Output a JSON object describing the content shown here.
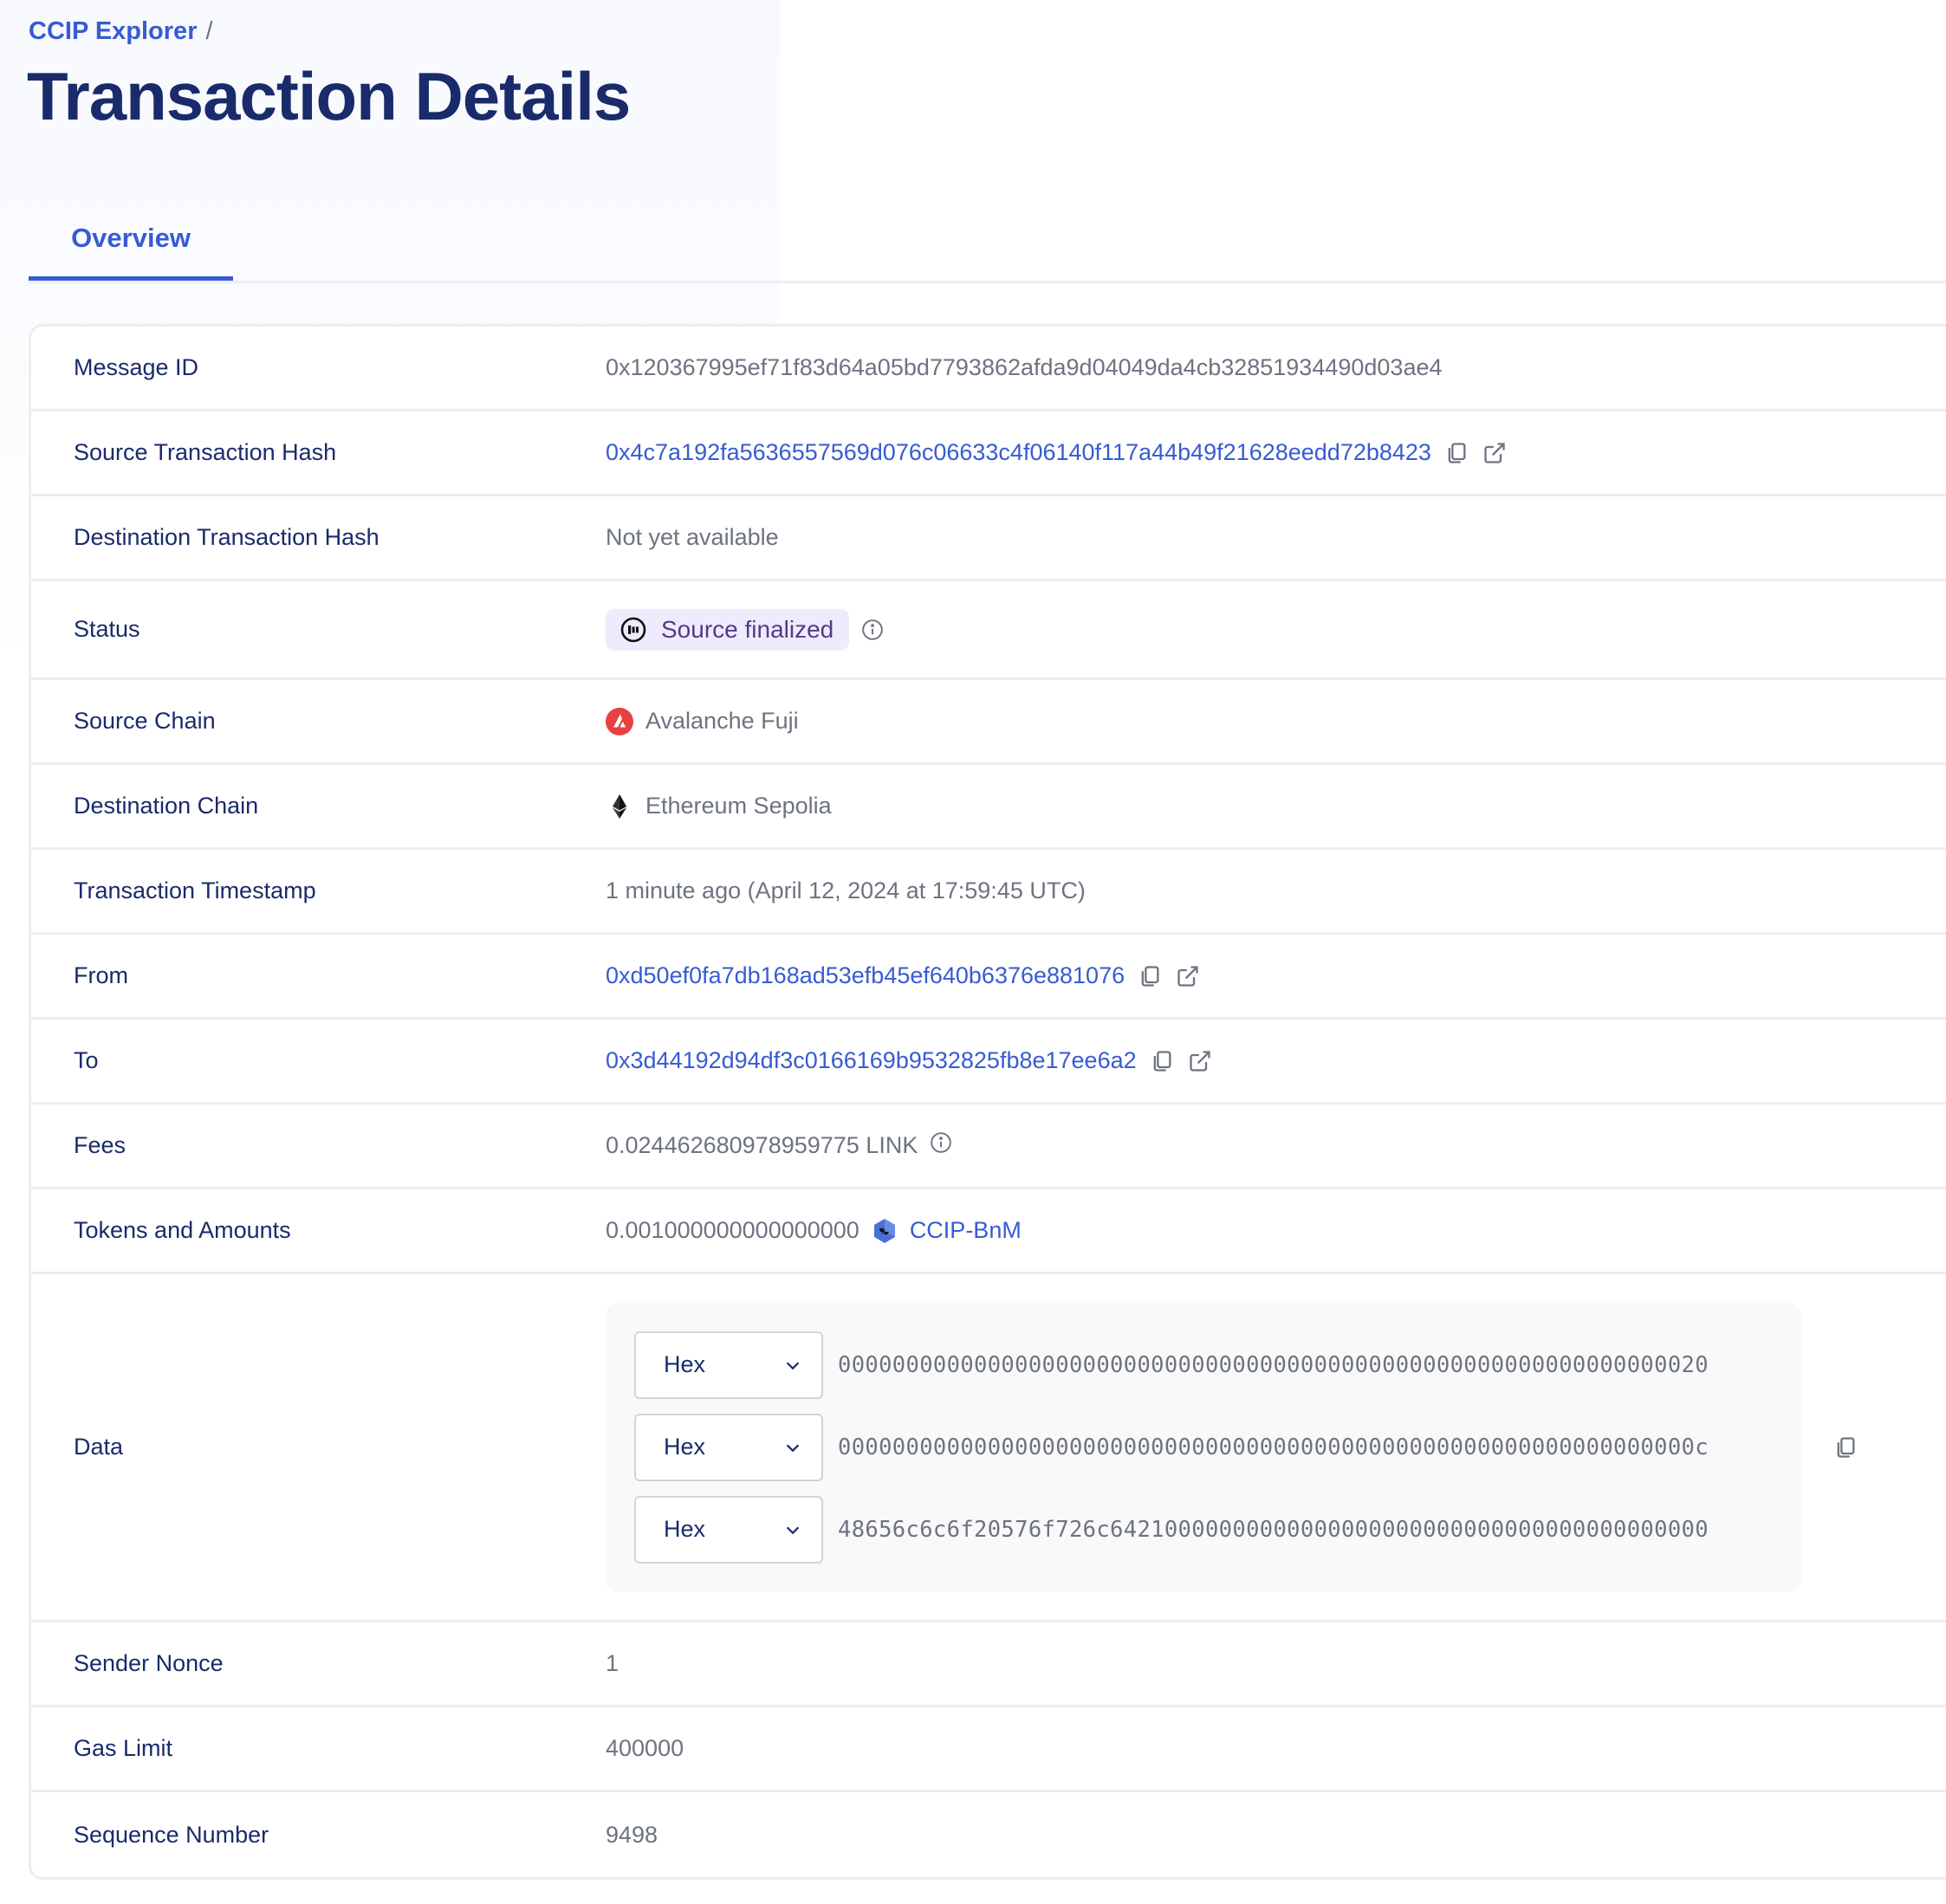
{
  "breadcrumb": {
    "root": "CCIP Explorer",
    "separator": "/"
  },
  "page_title": "Transaction Details",
  "tabs": [
    {
      "label": "Overview",
      "active": true
    }
  ],
  "colors": {
    "accent": "#375bd2",
    "heading": "#1a2b6b",
    "muted": "#6d7380",
    "badge_bg": "#efebfc",
    "badge_text": "#4f3c8c",
    "avalanche_red": "#e84142"
  },
  "details": {
    "message_id": {
      "label": "Message ID",
      "value": "0x120367995ef71f83d64a05bd7793862afda9d04049da4cb32851934490d03ae4"
    },
    "source_tx_hash": {
      "label": "Source Transaction Hash",
      "value": "0x4c7a192fa5636557569d076c06633c4f06140f117a44b49f21628eedd72b8423",
      "icons": [
        "copy-icon",
        "external-link-icon"
      ]
    },
    "dest_tx_hash": {
      "label": "Destination Transaction Hash",
      "value": "Not yet available"
    },
    "status": {
      "label": "Status",
      "value": "Source finalized",
      "icon": "status-finalized-icon",
      "info_icon": "info-icon"
    },
    "source_chain": {
      "label": "Source Chain",
      "value": "Avalanche Fuji",
      "icon": "avalanche-icon"
    },
    "dest_chain": {
      "label": "Destination Chain",
      "value": "Ethereum Sepolia",
      "icon": "ethereum-icon"
    },
    "timestamp": {
      "label": "Transaction Timestamp",
      "value": "1 minute ago (April 12, 2024 at 17:59:45 UTC)"
    },
    "from": {
      "label": "From",
      "value": "0xd50ef0fa7db168ad53efb45ef640b6376e881076",
      "icons": [
        "copy-icon",
        "external-link-icon"
      ]
    },
    "to": {
      "label": "To",
      "value": "0x3d44192d94df3c0166169b9532825fb8e17ee6a2",
      "icons": [
        "copy-icon",
        "external-link-icon"
      ]
    },
    "fees": {
      "label": "Fees",
      "value": "0.024462680978959775 LINK",
      "info_icon": "info-icon"
    },
    "tokens": {
      "label": "Tokens and Amounts",
      "amount": "0.001000000000000000",
      "token": "CCIP-BnM",
      "icon": "ccip-bnm-token-icon"
    },
    "data": {
      "label": "Data",
      "lines": [
        {
          "format": "Hex",
          "value": "0000000000000000000000000000000000000000000000000000000000000020"
        },
        {
          "format": "Hex",
          "value": "000000000000000000000000000000000000000000000000000000000000000c"
        },
        {
          "format": "Hex",
          "value": "48656c6c6f20576f726c64210000000000000000000000000000000000000000"
        }
      ],
      "copy_icon": "copy-icon"
    },
    "sender_nonce": {
      "label": "Sender Nonce",
      "value": "1"
    },
    "gas_limit": {
      "label": "Gas Limit",
      "value": "400000"
    },
    "sequence_number": {
      "label": "Sequence Number",
      "value": "9498"
    }
  }
}
